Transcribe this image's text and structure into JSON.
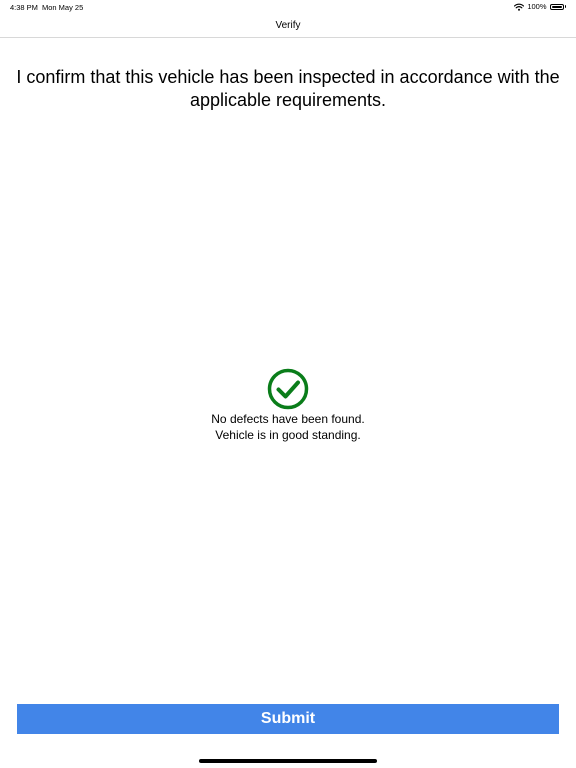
{
  "status_bar": {
    "time": "4:38 PM",
    "date": "Mon May 25",
    "battery_text": "100%",
    "battery_level": 1.0,
    "icons": [
      "wifi-icon",
      "battery-icon"
    ]
  },
  "nav": {
    "title": "Verify"
  },
  "main": {
    "confirm_text": "I confirm that this vehicle has been inspected in accordance with the applicable requirements.",
    "status_icon": "check-circle-icon",
    "status_line_1": "No defects have been found.",
    "status_line_2": "Vehicle is in good standing."
  },
  "footer": {
    "submit_label": "Submit"
  },
  "colors": {
    "check_green": "#0a7d1a",
    "submit_blue": "#4285e8",
    "submit_text": "#ffffff"
  }
}
